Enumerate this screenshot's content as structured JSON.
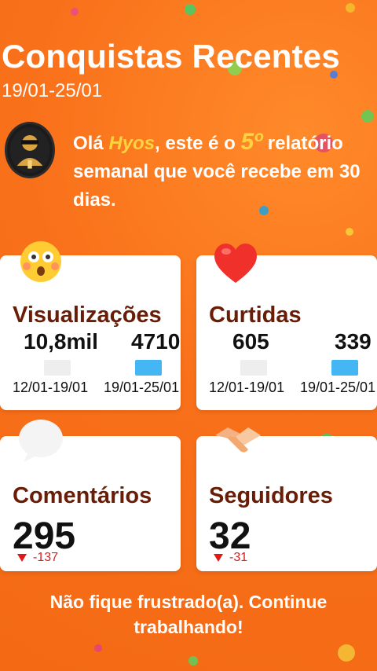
{
  "header": {
    "title": "Conquistas Recentes",
    "date_range": "19/01-25/01"
  },
  "intro": {
    "greeting": "Olá ",
    "user_name": "Hyos",
    "mid_text": ", este é o ",
    "rank": "5º",
    "tail_text": " relatório semanal que você recebe em 30 dias."
  },
  "cards": {
    "views": {
      "title": "Visualizações",
      "previous_value": "10,8mil",
      "current_value": "4710",
      "previous_period": "12/01-19/01",
      "current_period": "19/01-25/01"
    },
    "likes": {
      "title": "Curtidas",
      "previous_value": "605",
      "current_value": "339",
      "previous_period": "12/01-19/01",
      "current_period": "19/01-25/01"
    },
    "comments": {
      "title": "Comentários",
      "value": "295",
      "delta": "-137"
    },
    "followers": {
      "title": "Seguidores",
      "value": "32",
      "delta": "-31"
    }
  },
  "footer": {
    "message_line1": "Não fique frustrado(a). Continue",
    "message_line2": "trabalhando!"
  },
  "icons": {
    "views": "shocked-face-icon",
    "likes": "heart-icon",
    "comments": "speech-bubble-icon",
    "followers": "handshake-icon",
    "avatar": "profile-avatar"
  },
  "colors": {
    "background": "#f46a14",
    "accent_yellow": "#ffd23f",
    "card_title": "#6a1d06",
    "bar_current": "#43b6f3",
    "bar_previous": "#eeeeee",
    "negative": "#e21919"
  }
}
